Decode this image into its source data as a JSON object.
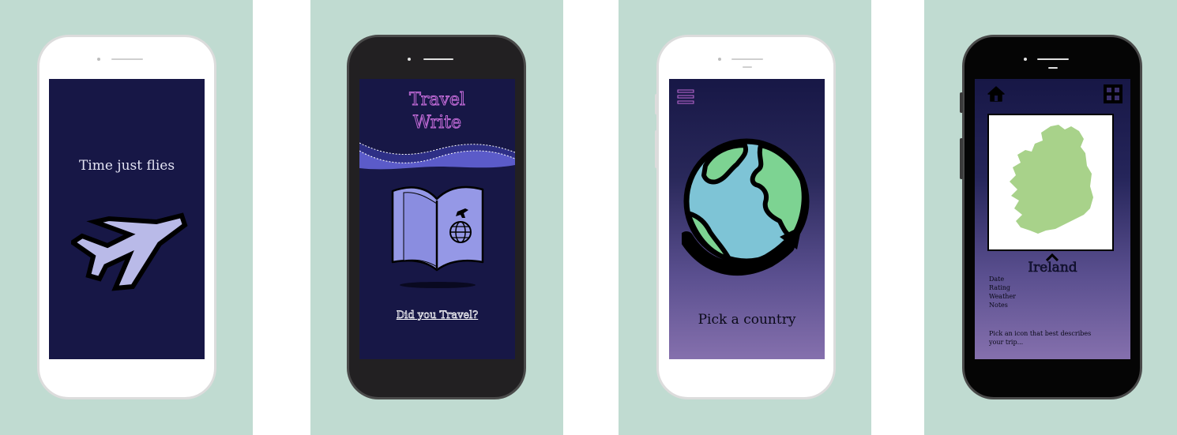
{
  "screens": {
    "splash": {
      "tagline": "Time just flies"
    },
    "home": {
      "title_line1": "Travel",
      "title_line2": "Write",
      "cta": "Did you Travel?"
    },
    "picker": {
      "prompt": "Pick a country"
    },
    "detail": {
      "country": "Ireland",
      "fields": [
        "Date",
        "Rating",
        "Weather",
        "Notes"
      ],
      "hint_line1": "Pick an icon that best describes",
      "hint_line2": "your trip..."
    }
  },
  "icons": {
    "splash": "airplane-icon",
    "home": "open-passport-icon",
    "picker": "globe-icon",
    "detail_left": "home-icon",
    "detail_right": "grid-icon"
  },
  "colors": {
    "panel_bg": "#c0dbd1",
    "screen_navy": "#171746",
    "accent_purple": "#c06ad6",
    "lavender": "#b9bae8",
    "globe_blue": "#7ec4d6",
    "globe_green": "#7dd392",
    "map_green": "#a8d28a"
  }
}
